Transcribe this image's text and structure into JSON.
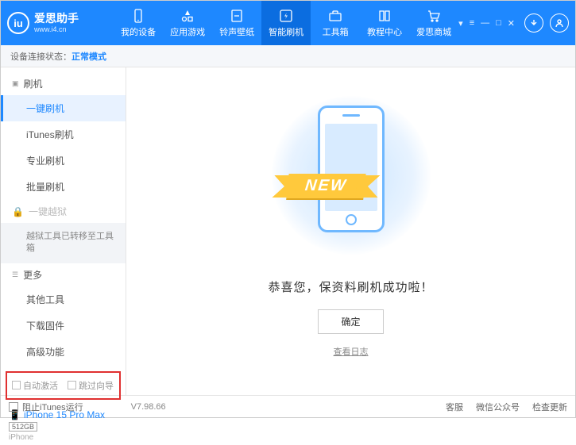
{
  "logo": {
    "mark": "iu",
    "title": "爱思助手",
    "sub": "www.i4.cn"
  },
  "nav": [
    {
      "label": "我的设备"
    },
    {
      "label": "应用游戏"
    },
    {
      "label": "铃声壁纸"
    },
    {
      "label": "智能刷机",
      "active": true
    },
    {
      "label": "工具箱"
    },
    {
      "label": "教程中心"
    },
    {
      "label": "爱思商城"
    }
  ],
  "status": {
    "label": "设备连接状态：",
    "mode": "正常模式"
  },
  "sidebar": {
    "flash_section": "刷机",
    "flash_items": [
      "一键刷机",
      "iTunes刷机",
      "专业刷机",
      "批量刷机"
    ],
    "jailbreak_label": "一键越狱",
    "jailbreak_note": "越狱工具已转移至工具箱",
    "more_section": "更多",
    "more_items": [
      "其他工具",
      "下载固件",
      "高级功能"
    ],
    "auto_activate": "自动激活",
    "skip_guide": "跳过向导"
  },
  "device": {
    "name": "iPhone 15 Pro Max",
    "storage": "512GB",
    "type": "iPhone"
  },
  "main": {
    "ribbon": "NEW",
    "message": "恭喜您，保资料刷机成功啦！",
    "ok": "确定",
    "log": "查看日志"
  },
  "footer": {
    "block_itunes": "阻止iTunes运行",
    "version": "V7.98.66",
    "links": [
      "客服",
      "微信公众号",
      "检查更新"
    ]
  }
}
